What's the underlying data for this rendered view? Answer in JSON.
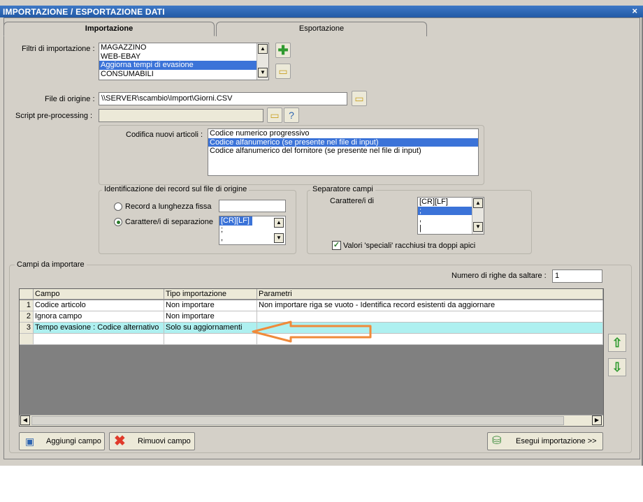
{
  "window": {
    "title": "IMPORTAZIONE / ESPORTAZIONE DATI",
    "close": "×"
  },
  "tabs": [
    {
      "label": "Importazione"
    },
    {
      "label": "Esportazione"
    }
  ],
  "filters": {
    "label": "Filtri di importazione :",
    "items": [
      "MAGAZZINO",
      "WEB-EBAY",
      "Aggiorna tempi di evasione",
      "CONSUMABILI"
    ],
    "selected_index": 2
  },
  "source_file": {
    "label": "File di origine :",
    "value": "\\\\SERVER\\scambio\\Import\\Giorni.CSV"
  },
  "script": {
    "label": "Script pre-processing :",
    "value": ""
  },
  "coding": {
    "label": "Codifica nuovi articoli :",
    "items": [
      "Codice numerico progressivo",
      "Codice alfanumerico (se presente nel file di input)",
      "Codice alfanumerico del fornitore (se presente nel file di input)"
    ],
    "selected_index": 1
  },
  "identification": {
    "title": "Identificazione dei record sul file di origine",
    "option_fixed": "Record a lunghezza fissa",
    "option_sep": "Carattere/i di separazione",
    "sep_items": [
      "[CR][LF]",
      ";",
      ","
    ]
  },
  "separator": {
    "title": "Separatore campi",
    "label": "Carattere/i di",
    "items": [
      "[CR][LF]",
      ";",
      ",",
      "|"
    ],
    "quotes_label": "Valori 'speciali' racchiusi tra doppi apici"
  },
  "fields": {
    "title": "Campi da importare",
    "skip_label": "Numero di righe da saltare :",
    "skip_value": "1",
    "columns": [
      "Campo",
      "Tipo importazione",
      "Parametri"
    ],
    "rows": [
      {
        "n": "1",
        "campo": "Codice articolo",
        "tipo": "Non importare",
        "param": "Non importare riga se vuoto - Identifica record esistenti da aggiornare"
      },
      {
        "n": "2",
        "campo": "Ignora campo",
        "tipo": "Non importare",
        "param": ""
      },
      {
        "n": "3",
        "campo": "Tempo evasione : Codice alternativo",
        "tipo": "Solo su aggiornamenti",
        "param": ""
      }
    ]
  },
  "buttons": {
    "add": "Aggiungi campo",
    "remove": "Rimuovi campo",
    "run": "Esegui importazione >>"
  },
  "colors": {
    "title_bar": "#2d64b0",
    "selection": "#3b73d8",
    "highlight_row": "#aef0f0",
    "arrow": "#f08a3a",
    "move_arrow": "#2f9a2f"
  }
}
